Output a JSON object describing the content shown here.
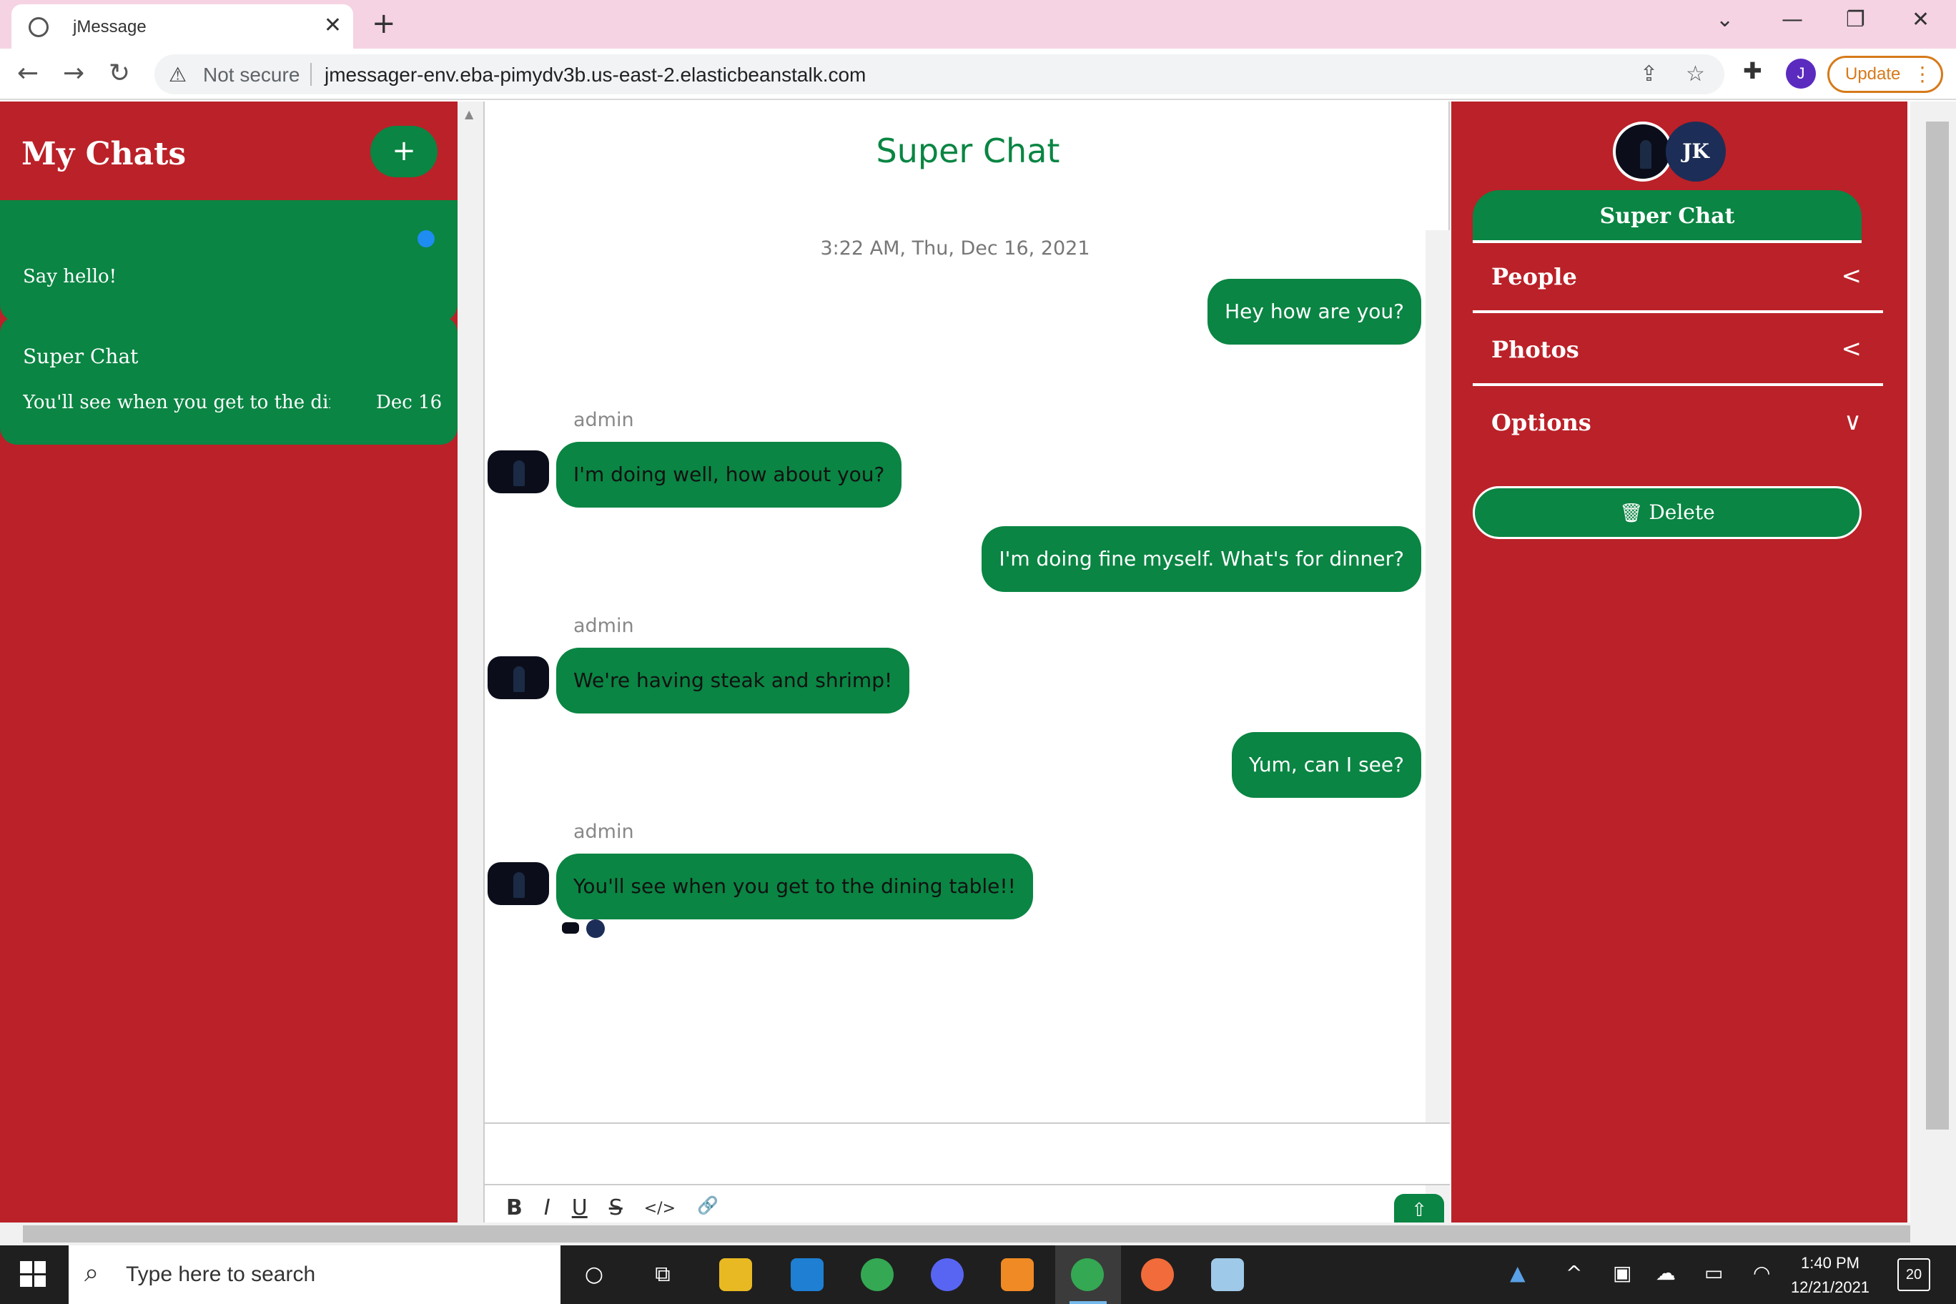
{
  "browser": {
    "tab_title": "jMessage",
    "not_secure": "Not secure",
    "url": "jmessager-env.eba-pimydv3b.us-east-2.elasticbeanstalk.com",
    "profile_initial": "J",
    "update_label": "Update"
  },
  "left": {
    "heading": "My Chats",
    "add_label": "+",
    "chats": [
      {
        "name": "",
        "preview": "Say hello!",
        "date": "",
        "unread": true
      },
      {
        "name": "Super Chat",
        "preview": "You'll see when you get to the dining table!!",
        "date": "Dec 16",
        "unread": false
      }
    ]
  },
  "center": {
    "title": "Super Chat",
    "timestamp": "3:22 AM, Thu, Dec 16, 2021",
    "messages": [
      {
        "dir": "out",
        "sender": "",
        "text": "Hey how are you?"
      },
      {
        "dir": "in",
        "sender": "admin",
        "text": "I'm doing well, how about you?"
      },
      {
        "dir": "out",
        "sender": "",
        "text": "I'm doing fine myself. What's for dinner?"
      },
      {
        "dir": "in",
        "sender": "admin",
        "text": "We're having steak and shrimp!"
      },
      {
        "dir": "out",
        "sender": "",
        "text": "Yum, can I see?"
      },
      {
        "dir": "in",
        "sender": "admin",
        "text": "You'll see when you get to the dining table!!"
      }
    ],
    "toolbar": [
      "B",
      "I",
      "U",
      "S",
      "</>",
      "🔗"
    ]
  },
  "right": {
    "avatar_initials": "JK",
    "chat_name": "Super Chat",
    "sections": [
      {
        "label": "People",
        "chevron": "<"
      },
      {
        "label": "Photos",
        "chevron": "<"
      },
      {
        "label": "Options",
        "chevron": "∨"
      }
    ],
    "delete_label": "Delete"
  },
  "taskbar": {
    "search_placeholder": "Type here to search",
    "time": "1:40 PM",
    "date": "12/21/2021",
    "notifications": "20"
  },
  "colors": {
    "red": "#bb2128",
    "green": "#0a8543",
    "navy": "#1c2e57"
  }
}
